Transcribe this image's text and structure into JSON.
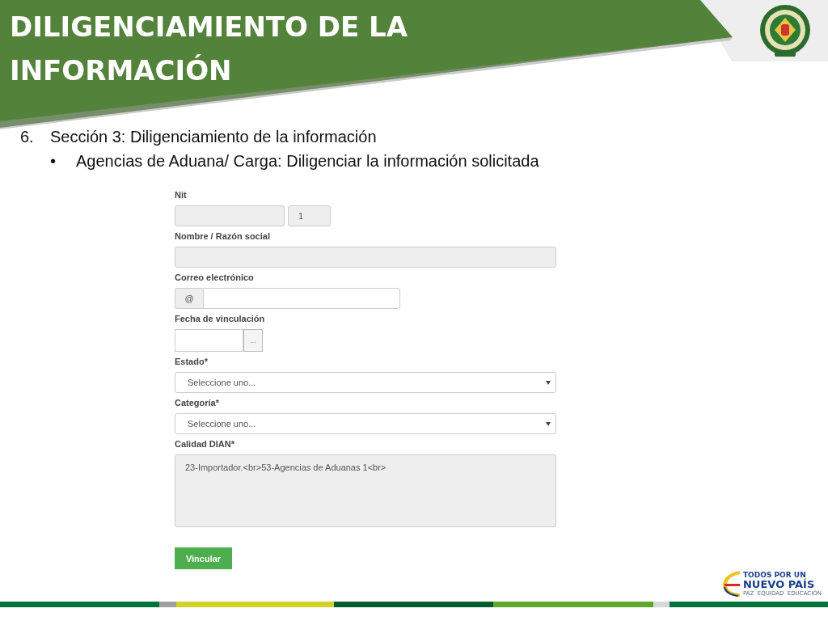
{
  "slide": {
    "title": "DILIGENCIAMIENTO DE LA INFORMACIÓN"
  },
  "steps": [
    {
      "number": "6.",
      "text": "Sección 3: Diligenciamiento de la información",
      "bullets": [
        {
          "marker": "•",
          "text": "Agencias de Aduana/ Carga: Diligenciar la información solicitada"
        }
      ]
    }
  ],
  "form": {
    "fields": [
      {
        "kind": "nit",
        "label": "Nit",
        "check_digit": "1",
        "disabled": true
      },
      {
        "kind": "text",
        "label": "Nombre / Razón social",
        "disabled": true
      },
      {
        "kind": "addon",
        "label": "Correo electrónico",
        "addon": "@",
        "disabled": false
      },
      {
        "kind": "date",
        "label": "Fecha de vinculación",
        "button": "...",
        "disabled": false
      },
      {
        "kind": "select",
        "label": "Estado*",
        "value": "Seleccione uno...",
        "disabled": false
      },
      {
        "kind": "select",
        "label": "Categoría*",
        "value": "Seleccione uno...",
        "disabled": false
      },
      {
        "kind": "textarea",
        "label": "Calidad DIAN*",
        "value": "23-Importador.<br>53-Agencias de Aduanas 1<br>",
        "disabled": true
      }
    ],
    "submit": "Vincular"
  },
  "footer": {
    "logo_lines": [
      "TODOS POR UN",
      "NUEVO PAÍS"
    ],
    "logo_tagline": "PAZ  EQUIDAD  EDUCACIÓN"
  }
}
